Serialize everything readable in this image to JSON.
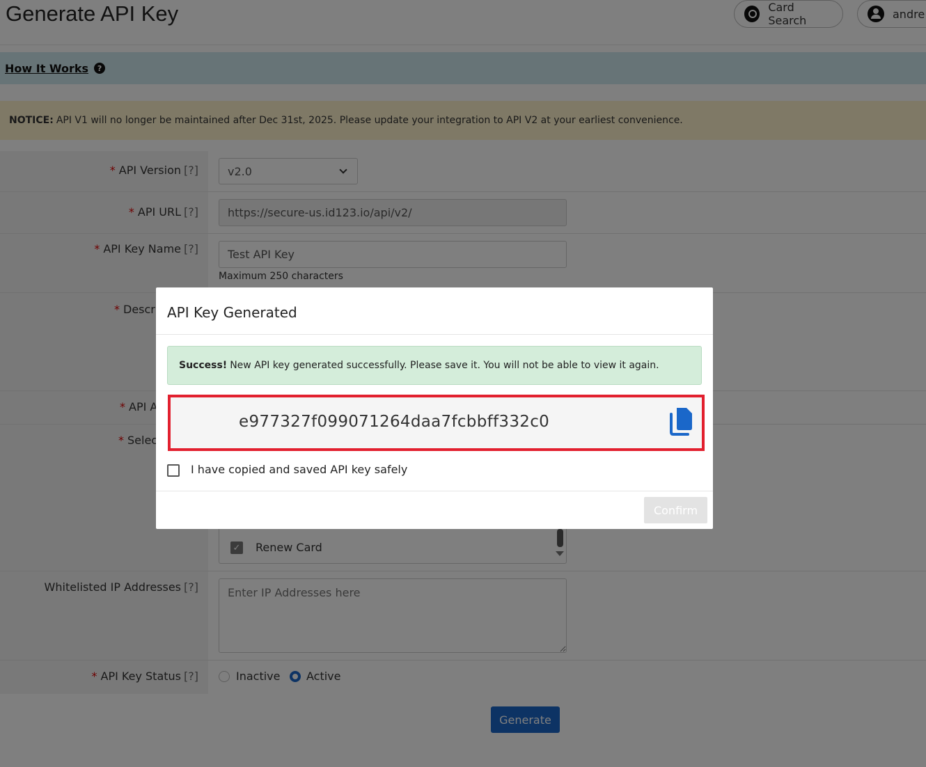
{
  "header": {
    "title": "Generate API Key",
    "card_search_label": "Card Search",
    "user_label": "andre"
  },
  "how_it_works": {
    "label": "How It Works",
    "help": "?"
  },
  "notice": {
    "prefix": "NOTICE:",
    "text": "API V1 will no longer be maintained after Dec 31st, 2025. Please update your integration to API V2 at your earliest convenience."
  },
  "form": {
    "required_mark": "*",
    "hint_mark": "[?]",
    "api_version": {
      "label": "API Version",
      "value": "v2.0"
    },
    "api_url": {
      "label": "API URL",
      "value": "https://secure-us.id123.io/api/v2/"
    },
    "api_key_name": {
      "label": "API Key Name",
      "value": "Test API Key",
      "helper": "Maximum 250 characters"
    },
    "description": {
      "label": "Descri"
    },
    "api_access": {
      "label": "API A"
    },
    "select": {
      "label": "Selec",
      "visible_option": "Renew Card"
    },
    "whitelisted_ip": {
      "label": "Whitelisted IP Addresses",
      "placeholder": "Enter IP Addresses here"
    },
    "api_key_status": {
      "label": "API Key Status",
      "options": [
        "Inactive",
        "Active"
      ],
      "selected": "Active"
    },
    "generate_label": "Generate"
  },
  "modal": {
    "title": "API Key Generated",
    "success_prefix": "Success!",
    "success_text": "New API key generated successfully. Please save it. You will not be able to view it again.",
    "api_key": "e977327f099071264daa7fcbbff332c0",
    "confirm_checkbox_label": "I have copied and saved API key safely",
    "confirm_label": "Confirm"
  },
  "colors": {
    "primary": "#1a67c9",
    "highlight_border": "#e2202f",
    "success_bg": "#d4edda",
    "notice_bg": "#fff3cd",
    "info_bg": "#cfe8ee"
  }
}
